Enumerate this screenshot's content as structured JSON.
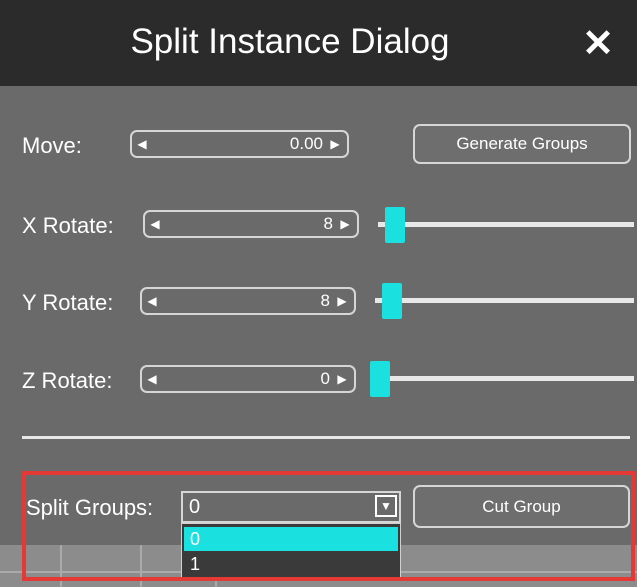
{
  "dialog": {
    "title": "Split Instance Dialog",
    "close_glyph": "✕"
  },
  "move": {
    "label": "Move:",
    "value": "0.00",
    "arrow_left": "◀",
    "arrow_right": "▶"
  },
  "generate_groups": {
    "label": "Generate Groups"
  },
  "x_rotate": {
    "label": "X Rotate:",
    "value": "8",
    "slider_level": 0.03
  },
  "y_rotate": {
    "label": "Y Rotate:",
    "value": "8",
    "slider_level": 0.03
  },
  "z_rotate": {
    "label": "Z Rotate:",
    "value": "0",
    "slider_level": 0.0
  },
  "split_groups": {
    "label": "Split Groups:",
    "selected_value": "0",
    "dropdown_arrow": "▼",
    "options": [
      "0",
      "1"
    ]
  },
  "cut_group": {
    "label": "Cut Group"
  },
  "colors": {
    "accent": "#1ae0e0",
    "titlebar": "#2b2b2b",
    "panel": "#6a6a6a",
    "highlight": "#e53935"
  },
  "icons": {
    "close": "close-icon",
    "decrement": "arrow-left-icon",
    "increment": "arrow-right-icon",
    "dropdown": "chevron-down-icon"
  }
}
